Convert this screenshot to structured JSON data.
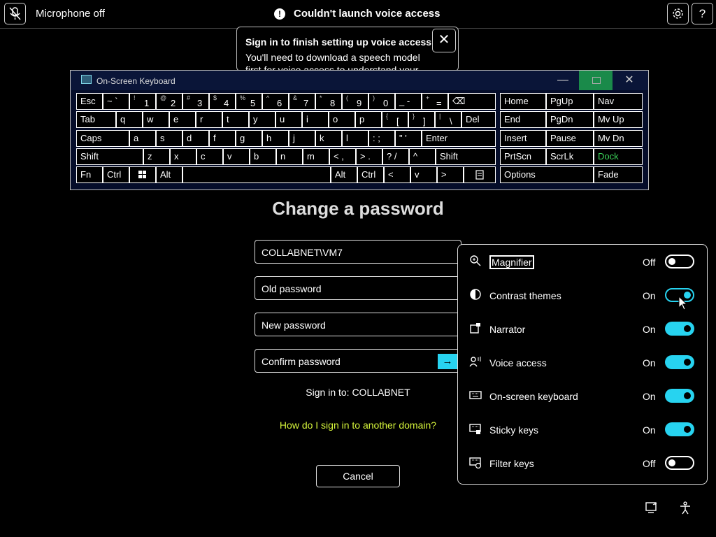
{
  "topbar": {
    "mic_label": "Microphone off",
    "warning": "Couldn't launch voice access",
    "warning_icon": "exclamation-icon",
    "settings_icon": "gear-icon",
    "help_label": "?"
  },
  "popup": {
    "title": "Sign in to finish setting up voice access",
    "body": "You'll need to download a speech model first for voice access to understand your",
    "close_label": "✕"
  },
  "osk": {
    "title": "On-Screen Keyboard",
    "min_label": "—",
    "close_label": "✕",
    "keys": {
      "esc": "Esc",
      "tilde_s": "~ `",
      "k1_s": "!",
      "k1": "1",
      "k2_s": "@",
      "k2": "2",
      "k3_s": "#",
      "k3": "3",
      "k4_s": "$",
      "k4": "4",
      "k5_s": "%",
      "k5": "5",
      "k6_s": "^",
      "k6": "6",
      "k7_s": "&",
      "k7": "7",
      "k8_s": "*",
      "k8": "8",
      "k9_s": "(",
      "k9": "9",
      "k0_s": ")",
      "k0": "0",
      "minus": "_ -",
      "plus_s": "+",
      "equal": "=",
      "bksp": "⌫",
      "home": "Home",
      "pgup": "PgUp",
      "nav": "Nav",
      "tab": "Tab",
      "q": "q",
      "w": "w",
      "e": "e",
      "r": "r",
      "t": "t",
      "y": "y",
      "u": "u",
      "i": "i",
      "o": "o",
      "p": "p",
      "lbr_s": "{",
      "lbr": "[",
      "rbr_s": "}",
      "rbr": "]",
      "bsl_s": "|",
      "bsl": "\\",
      "del": "Del",
      "end": "End",
      "pgdn": "PgDn",
      "mvup": "Mv Up",
      "caps": "Caps",
      "a": "a",
      "s": "s",
      "d": "d",
      "f": "f",
      "g": "g",
      "h": "h",
      "j": "j",
      "k": "k",
      "l": "l",
      "semi": ": ;",
      "quote": "\" '",
      "enter": "Enter",
      "insert": "Insert",
      "pause": "Pause",
      "mvdn": "Mv Dn",
      "shift": "Shift",
      "z": "z",
      "x": "x",
      "c": "c",
      "v": "v",
      "b": "b",
      "n": "n",
      "m": "m",
      "comma": "< ,",
      "period": "> .",
      "slash": "? /",
      "up": "^",
      "shift2": "Shift",
      "prtscn": "PrtScn",
      "scrlk": "ScrLk",
      "dock": "Dock",
      "fn": "Fn",
      "ctrl": "Ctrl",
      "win": "win-icon",
      "alt": "Alt",
      "alt2": "Alt",
      "ctrl2": "Ctrl",
      "left": "<",
      "down": "v",
      "right": ">",
      "menu": "menu-icon",
      "options": "Options",
      "fade": "Fade"
    },
    "dock_color": "#3cd65a"
  },
  "form": {
    "title": "Change a password",
    "user_value": "COLLABNET\\VM7",
    "old_placeholder": "Old password",
    "new_placeholder": "New password",
    "confirm_placeholder": "Confirm password",
    "submit_arrow": "→",
    "signin": "Sign in to: COLLABNET",
    "domain_link": "How do I sign in to another domain?",
    "cancel": "Cancel",
    "accent": "#27d3f0",
    "link_color": "#d6f53b"
  },
  "panel": {
    "items": [
      {
        "label": "Magnifier",
        "state": "Off",
        "icon": "magnifier-icon"
      },
      {
        "label": "Contrast themes",
        "state": "On",
        "icon": "contrast-icon"
      },
      {
        "label": "Narrator",
        "state": "On",
        "icon": "narrator-icon"
      },
      {
        "label": "Voice access",
        "state": "On",
        "icon": "voice-access-icon"
      },
      {
        "label": "On-screen keyboard",
        "state": "On",
        "icon": "keyboard-icon"
      },
      {
        "label": "Sticky keys",
        "state": "On",
        "icon": "sticky-keys-icon"
      },
      {
        "label": "Filter keys",
        "state": "Off",
        "icon": "filter-keys-icon"
      }
    ]
  },
  "bottom": {
    "network_icon": "network-icon",
    "accessibility_icon": "accessibility-icon"
  }
}
